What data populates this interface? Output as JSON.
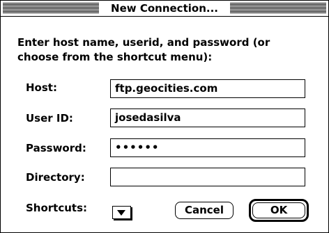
{
  "window": {
    "title": "New Connection..."
  },
  "prompt": {
    "line1": "Enter host name, userid, and password (or",
    "line2": "choose from the shortcut menu):"
  },
  "fields": {
    "host": {
      "label": "Host:",
      "value": "ftp.geocities.com"
    },
    "userid": {
      "label": "User ID:",
      "value": "josedasilva"
    },
    "password": {
      "label": "Password:",
      "value": "••••••"
    },
    "directory": {
      "label": "Directory:",
      "value": ""
    }
  },
  "shortcuts": {
    "label": "Shortcuts:"
  },
  "buttons": {
    "cancel": "Cancel",
    "ok": "OK"
  }
}
